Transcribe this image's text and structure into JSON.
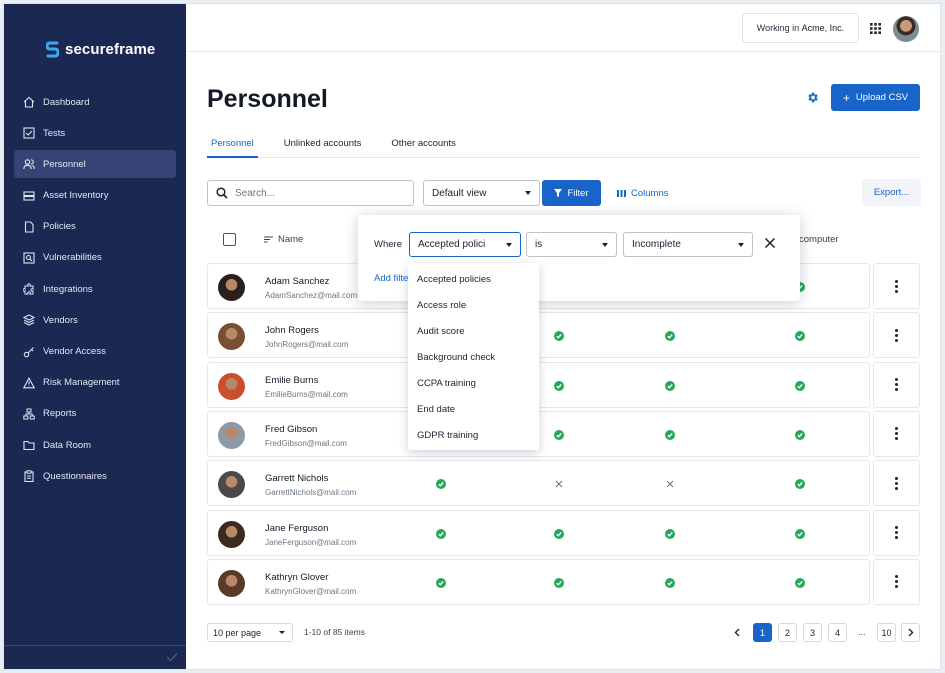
{
  "brand": {
    "name": "secureframe"
  },
  "sidebar": {
    "items": [
      {
        "label": "Dashboard",
        "icon": "home-icon"
      },
      {
        "label": "Tests",
        "icon": "checkbox-icon"
      },
      {
        "label": "Personnel",
        "icon": "users-icon",
        "active": true
      },
      {
        "label": "Asset Inventory",
        "icon": "server-icon"
      },
      {
        "label": "Policies",
        "icon": "document-icon"
      },
      {
        "label": "Vulnerabilities",
        "icon": "scan-icon"
      },
      {
        "label": "Integrations",
        "icon": "puzzle-icon"
      },
      {
        "label": "Vendors",
        "icon": "layers-icon"
      },
      {
        "label": "Vendor Access",
        "icon": "key-icon"
      },
      {
        "label": "Risk Management",
        "icon": "warning-icon"
      },
      {
        "label": "Reports",
        "icon": "hierarchy-icon"
      },
      {
        "label": "Data Room",
        "icon": "folder-icon"
      },
      {
        "label": "Questionnaires",
        "icon": "clipboard-icon"
      }
    ]
  },
  "topbar": {
    "workspace_prefix": "Working in ",
    "workspace_name": "Acme, Inc."
  },
  "page": {
    "title": "Personnel",
    "upload_label": "Upload CSV",
    "tabs": [
      "Personnel",
      "Unlinked accounts",
      "Other accounts"
    ],
    "search_placeholder": "Search...",
    "view_select": "Default view",
    "filter_label": "Filter",
    "columns_label": "Columns",
    "export_label": "Export..."
  },
  "table": {
    "header_name": "Name",
    "header_partial": "computer",
    "rows": [
      {
        "name": "Adam Sanchez",
        "email": "AdamSanchez@mail.com",
        "avatar": "#2a1f1a",
        "c1": "ok",
        "c2": "ok",
        "c3": "ok",
        "c4": "ok"
      },
      {
        "name": "John Rogers",
        "email": "JohnRogers@mail.com",
        "avatar": "#7a4f33",
        "c1": "ok",
        "c2": "ok",
        "c3": "ok",
        "c4": "ok"
      },
      {
        "name": "Emilie Burns",
        "email": "EmilieBurns@mail.com",
        "avatar": "#c8502e",
        "c1": "ok",
        "c2": "ok",
        "c3": "ok",
        "c4": "ok"
      },
      {
        "name": "Fred Gibson",
        "email": "FredGibson@mail.com",
        "avatar": "#8d9aa6",
        "c1": "ok",
        "c2": "ok",
        "c3": "ok",
        "c4": "ok"
      },
      {
        "name": "Garrett Nichols",
        "email": "GarrettNichols@mail.com",
        "avatar": "#4a4a4a",
        "c1": "ok",
        "c2": "no",
        "c3": "no",
        "c4": "ok"
      },
      {
        "name": "Jane Ferguson",
        "email": "JaneFerguson@mail.com",
        "avatar": "#3a2a22",
        "c1": "ok",
        "c2": "ok",
        "c3": "ok",
        "c4": "ok"
      },
      {
        "name": "Kathryn Glover",
        "email": "KathrynGlover@mail.com",
        "avatar": "#5a3a2a",
        "c1": "ok",
        "c2": "ok",
        "c3": "ok",
        "c4": "ok"
      }
    ]
  },
  "pagination": {
    "per_page": "10 per page",
    "range": "1-10 of 85 items",
    "pages": [
      "1",
      "2",
      "3",
      "4"
    ],
    "ellipsis": "...",
    "last": "10"
  },
  "filter_popover": {
    "where_label": "Where",
    "field": "Accepted polici",
    "operator": "is",
    "value": "Incomplete",
    "add_filter": "Add filter",
    "options": [
      "Accepted policies",
      "Access role",
      "Audit score",
      "Background check",
      "CCPA training",
      "End date",
      "GDPR training"
    ]
  },
  "colors": {
    "sidebar": "#1b2851",
    "primary": "#1864c8",
    "success": "#25a85a"
  }
}
